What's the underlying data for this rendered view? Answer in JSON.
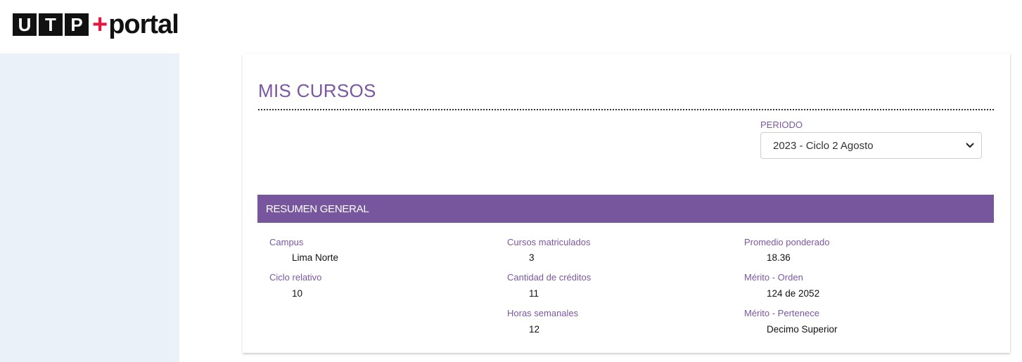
{
  "brand": {
    "logo_letters": [
      "U",
      "T",
      "P"
    ],
    "logo_plus": "+",
    "logo_word": "portal",
    "accent_color": "#77569e",
    "logo_plus_color": "#e5173f"
  },
  "page": {
    "title": "MIS CURSOS"
  },
  "periodo": {
    "label": "PERIODO",
    "selected": "2023 - Ciclo 2 Agosto"
  },
  "summary": {
    "header": "RESUMEN GENERAL",
    "campus_label": "Campus",
    "campus_value": "Lima Norte",
    "ciclo_label": "Ciclo relativo",
    "ciclo_value": "10",
    "cursos_label": "Cursos matriculados",
    "cursos_value": "3",
    "creditos_label": "Cantidad de créditos",
    "creditos_value": "11",
    "horas_label": "Horas semanales",
    "horas_value": "12",
    "promedio_label": "Promedio ponderado",
    "promedio_value": "18.36",
    "orden_label": "Mérito - Orden",
    "orden_value": "124 de 2052",
    "pertenece_label": "Mérito - Pertenece",
    "pertenece_value": "Decimo Superior"
  }
}
